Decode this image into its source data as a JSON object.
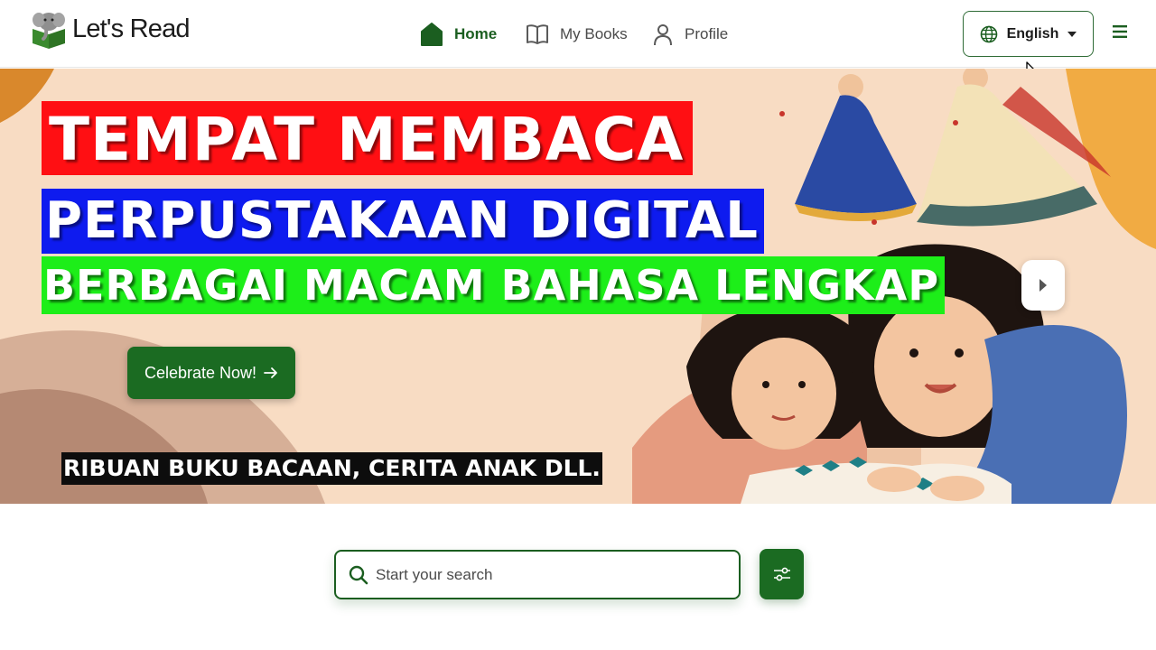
{
  "header": {
    "logo_text": "Let's Read",
    "nav": [
      {
        "label": "Home",
        "icon": "house-icon",
        "active": true
      },
      {
        "label": "My Books",
        "icon": "open-book-icon",
        "active": false
      },
      {
        "label": "Profile",
        "icon": "person-icon",
        "active": false
      }
    ],
    "language": {
      "selected": "English",
      "icon": "globe-icon"
    },
    "menu_icon": "hamburger-icon"
  },
  "hero": {
    "overlay_lines": [
      "TEMPAT MEMBACA",
      "PERPUSTAKAAN DIGITAL",
      "BERBAGAI MACAM BAHASA LENGKAP"
    ],
    "cta_label": "Celebrate Now!",
    "caption": "RIBUAN BUKU BACAAN, CERITA ANAK DLL.",
    "next_icon": "caret-right-icon"
  },
  "search": {
    "placeholder": "Start your search",
    "value": "",
    "filter_icon": "sliders-icon"
  },
  "colors": {
    "brand_green": "#1b6b22",
    "banner_red": "#ff0f13",
    "banner_blue": "#0e1bef",
    "banner_green": "#1dee19"
  }
}
